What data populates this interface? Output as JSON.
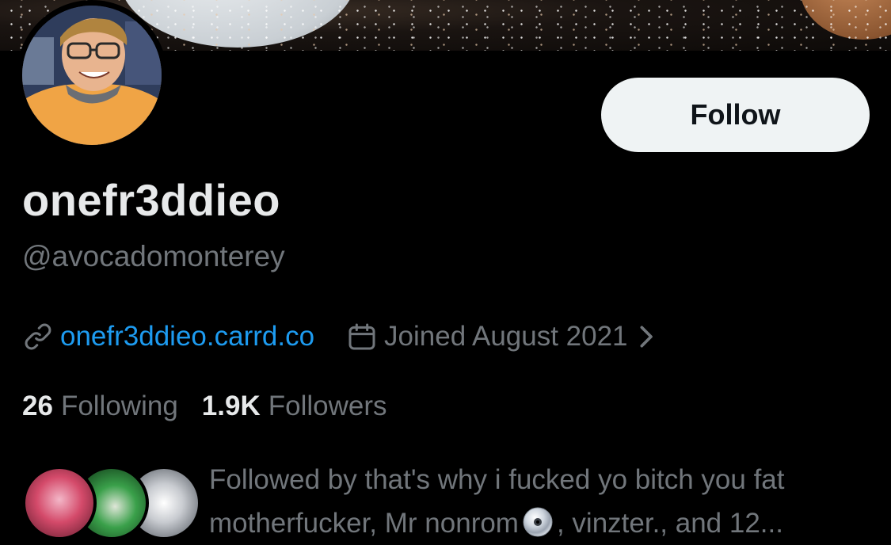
{
  "profile": {
    "display_name": "onefr3ddieo",
    "handle": "@avocadomonterey",
    "follow_label": "Follow",
    "website": "onefr3ddieo.carrd.co",
    "joined": "Joined August 2021",
    "following_count": "26",
    "following_label": "Following",
    "followers_count": "1.9K",
    "followers_label": "Followers",
    "followed_by_prefix": "Followed by that's why i fucked yo bitch you fat motherfucker, Mr nonrom",
    "followed_by_suffix": ", vinzter., and 12..."
  },
  "icons": {
    "link": "link-icon",
    "calendar": "calendar-icon",
    "chevron": "chevron-right-icon",
    "disc": "cd-icon"
  },
  "colors": {
    "background": "#000000",
    "primary_text": "#e7e9ea",
    "secondary_text": "#71767b",
    "link": "#1d9bf0",
    "button_bg": "#eff3f4",
    "button_text": "#0f1419"
  }
}
